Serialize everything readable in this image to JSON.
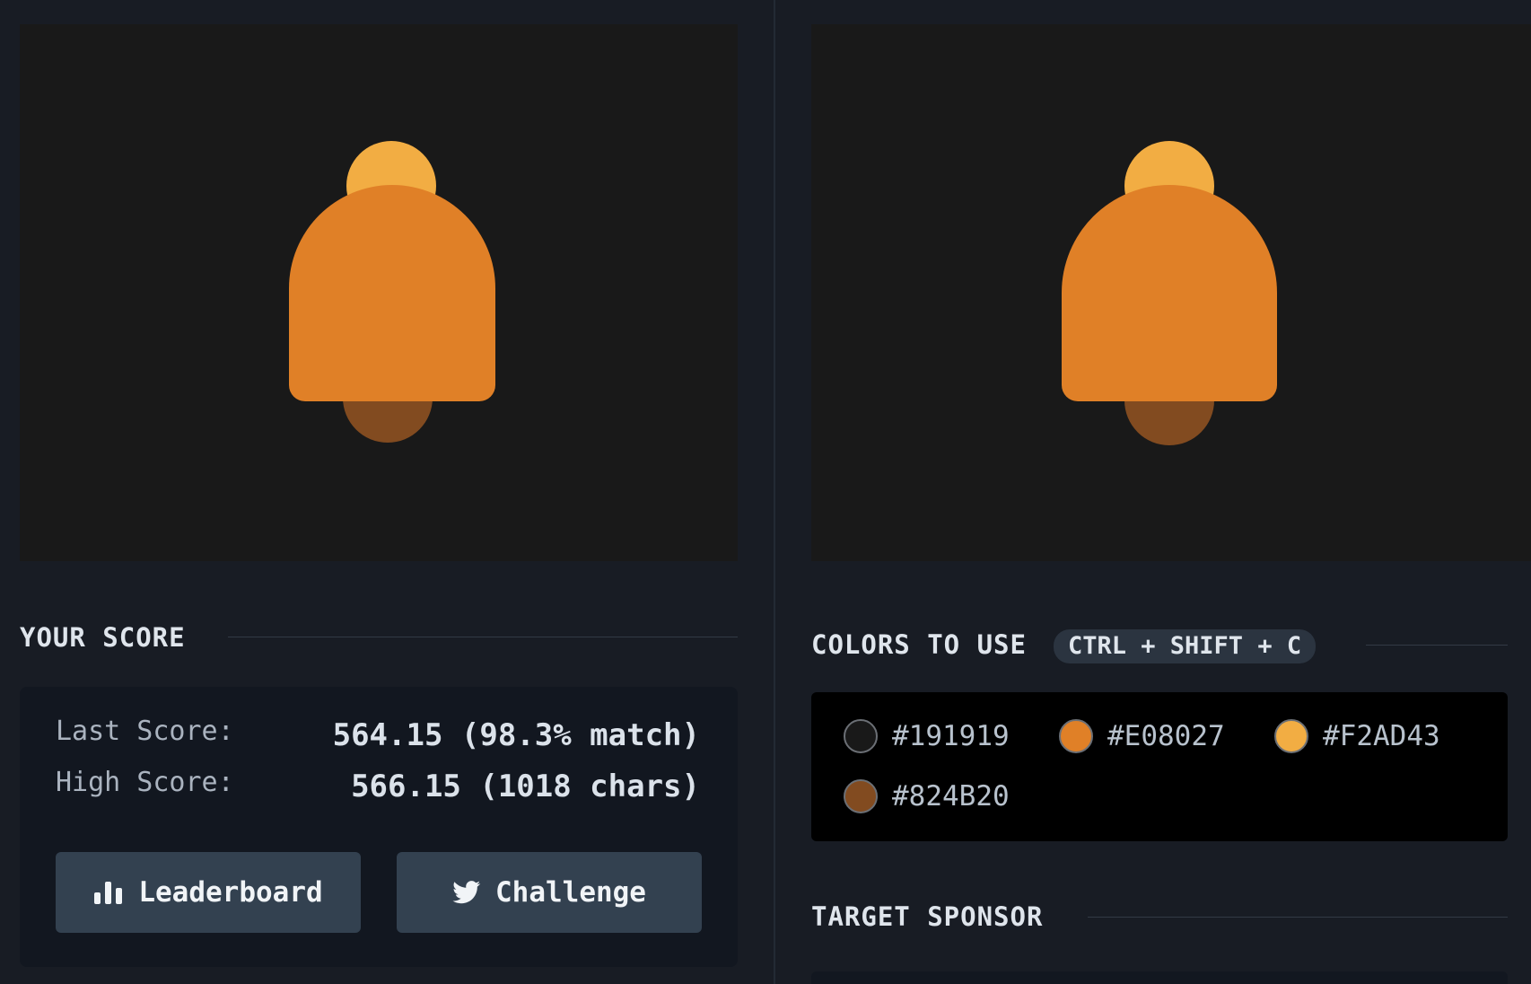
{
  "score": {
    "title": "YOUR SCORE",
    "last_label": "Last Score:",
    "last_value": "564.15 (98.3% match)",
    "high_label": "High Score:",
    "high_value": "566.15 (1018 chars)",
    "leaderboard_label": "Leaderboard",
    "challenge_label": "Challenge"
  },
  "colors": {
    "title": "COLORS TO USE",
    "shortcut": "CTRL + SHIFT + C",
    "swatches": [
      {
        "hex": "#191919"
      },
      {
        "hex": "#E08027"
      },
      {
        "hex": "#F2AD43"
      },
      {
        "hex": "#824B20"
      }
    ]
  },
  "sponsor": {
    "title": "TARGET SPONSOR"
  }
}
